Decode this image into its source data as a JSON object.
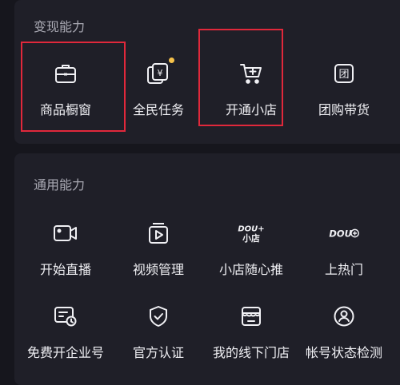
{
  "monetization": {
    "title": "变现能力",
    "items": [
      {
        "label": "商品橱窗",
        "icon": "shop-window-icon"
      },
      {
        "label": "全民任务",
        "icon": "task-coin-icon",
        "badge": true
      },
      {
        "label": "开通小店",
        "icon": "cart-icon"
      },
      {
        "label": "团购带货",
        "icon": "group-buy-icon"
      }
    ]
  },
  "general": {
    "title": "通用能力",
    "items": [
      {
        "label": "开始直播",
        "icon": "live-camera-icon"
      },
      {
        "label": "视频管理",
        "icon": "video-manage-icon"
      },
      {
        "label": "小店随心推",
        "icon": "dou-plus-shop-icon",
        "logo_text_line1": "DOU+",
        "logo_text_line2": "小店"
      },
      {
        "label": "上热门",
        "icon": "dou-plus-logo-icon",
        "logo_text": "DOU"
      },
      {
        "label": "免费开企业号",
        "icon": "enterprise-account-icon"
      },
      {
        "label": "官方认证",
        "icon": "shield-check-icon"
      },
      {
        "label": "我的线下门店",
        "icon": "storefront-icon"
      },
      {
        "label": "帐号状态检测",
        "icon": "account-status-icon"
      }
    ]
  },
  "colors": {
    "highlight": "#e0283b",
    "badge": "#f5c14a",
    "background": "#16161d",
    "card": "#1f1f28"
  }
}
